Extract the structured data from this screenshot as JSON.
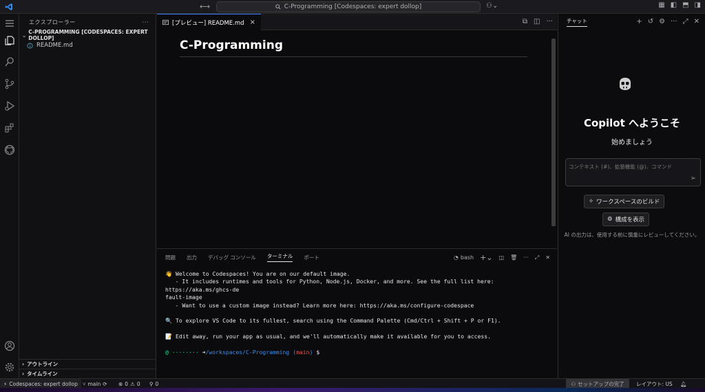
{
  "titlebar": {
    "command_center": "C-Programming [Codespaces: expert dollop]",
    "search_icon": "search-icon"
  },
  "sidebar": {
    "title": "エクスプローラー",
    "more": "···",
    "folder": "C-PROGRAMMING [CODESPACES: EXPERT DOLLOP]",
    "files": [
      {
        "name": "README.md",
        "icon": "info-icon"
      }
    ],
    "outline": "アウトライン",
    "timeline": "タイムライン"
  },
  "editor": {
    "tab_label": "[プレビュー] README.md",
    "tab_close": "×",
    "preview_heading": "C-Programming"
  },
  "panel": {
    "tabs": [
      "問題",
      "出力",
      "デバッグ コンソール",
      "ターミナル",
      "ポート"
    ],
    "active_tab": "ターミナル",
    "shell": "bash",
    "terminal_lines": [
      "👋 Welcome to Codespaces! You are on our default image.",
      "   - It includes runtimes and tools for Python, Node.js, Docker, and more. See the full list here: https://aka.ms/ghcs-de",
      "fault-image",
      "   - Want to use a custom image instead? Learn more here: https://aka.ms/configure-codespace",
      "",
      "🔍 To explore VS Code to its fullest, search using the Command Palette (Cmd/Ctrl + Shift + P or F1).",
      "",
      "📝 Edit away, run your app as usual, and we'll automatically make it available for you to access.",
      ""
    ],
    "prompt": {
      "at": "@",
      "user": "········",
      "arrow": "➜",
      "path": "/workspaces/C-Programming",
      "branch_open": "(",
      "branch": "main",
      "branch_close": ")",
      "symbol": "$"
    }
  },
  "chat": {
    "title": "チャット",
    "welcome": "Copilot へようこそ",
    "start": "始めましょう",
    "input_placeholder": "コンテキスト (#)、拡張機能 (@)、コマンド",
    "build_button": "ワークスペースのビルド",
    "config_button": "構成を表示",
    "note": "AI の出力は、使用する前に慎重にレビューしてください。"
  },
  "statusbar": {
    "remote": "Codespaces: expert dollop",
    "branch": "main",
    "errors": "0",
    "warnings": "0",
    "ports": "0",
    "setup": "セットアップの完了",
    "layout": "レイアウト: US"
  },
  "colors": {
    "accent": "#3b82f6",
    "terminal_green": "#23d18b",
    "terminal_blue": "#3b8eea",
    "terminal_red": "#e05656"
  }
}
